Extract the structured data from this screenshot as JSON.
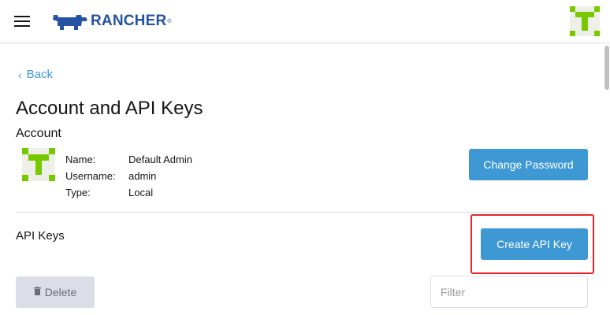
{
  "header": {
    "brand": "RANCHER",
    "brand_reg": "®",
    "logo_color": "#2453a4",
    "menu_icon": "hamburger-menu-icon",
    "avatar_icon": "user-identicon",
    "avatar_color": "#78c800"
  },
  "nav": {
    "back_chevron": "‹",
    "back_label": "Back"
  },
  "page": {
    "title": "Account and API Keys"
  },
  "account": {
    "section_title": "Account",
    "fields": [
      {
        "label": "Name:",
        "value": "Default Admin"
      },
      {
        "label": "Username:",
        "value": "admin"
      },
      {
        "label": "Type:",
        "value": "Local"
      }
    ],
    "change_password_label": "Change Password"
  },
  "api_keys": {
    "section_title": "API Keys",
    "create_label": "Create API Key",
    "delete_label": "Delete",
    "delete_icon": "trash-icon",
    "filter_placeholder": "Filter"
  },
  "colors": {
    "primary": "#3d98d3",
    "highlight": "#e5232a",
    "disabled": "#dcdee7"
  }
}
